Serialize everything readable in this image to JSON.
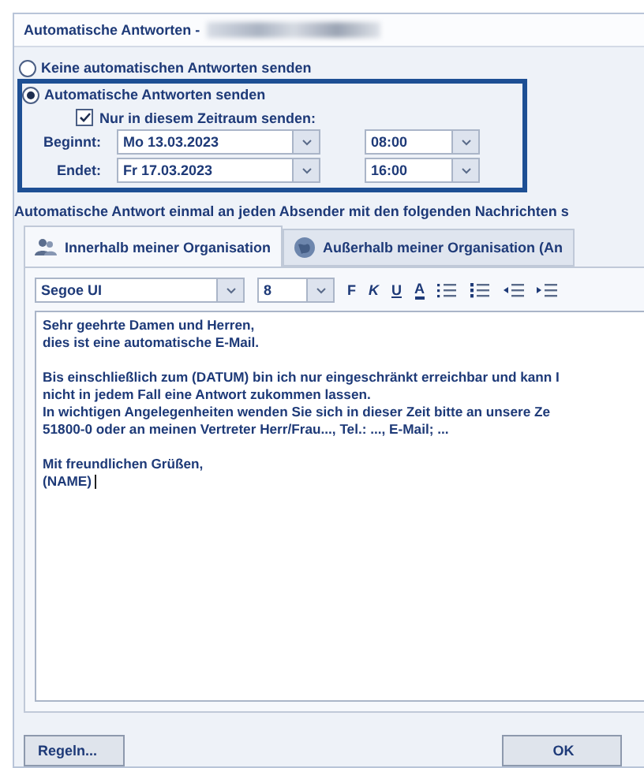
{
  "window": {
    "title": "Automatische Antworten -"
  },
  "options": [
    {
      "label": "Keine automatischen Antworten senden",
      "selected": false
    },
    {
      "label": "Automatische Antworten senden",
      "selected": true
    }
  ],
  "period": {
    "label": "Nur in diesem Zeitraum senden:",
    "checked": true,
    "rows": [
      {
        "label": "Beginnt:",
        "date": "Mo 13.03.2023",
        "time": "08:00"
      },
      {
        "label": "Endet:",
        "date": "Fr 17.03.2023",
        "time": "16:00"
      }
    ]
  },
  "info": "Automatische Antwort einmal an jeden Absender mit den folgenden Nachrichten s",
  "tabs": [
    {
      "label": "Innerhalb meiner Organisation",
      "selected": true,
      "kind": "people"
    },
    {
      "label": "Außerhalb meiner Organisation (An",
      "selected": false,
      "kind": "globe"
    }
  ],
  "toolbar": {
    "font": "Segoe UI",
    "size": "8",
    "formats": [
      {
        "label": "F",
        "kind": "bold"
      },
      {
        "label": "K",
        "kind": "italic"
      },
      {
        "label": "U",
        "kind": "underline"
      },
      {
        "label": "A",
        "kind": "color"
      }
    ]
  },
  "message": [
    [
      "Sehr geehrte Damen und Herren,",
      "dies ist eine automatische E-Mail."
    ],
    [
      "Bis einschließlich zum (DATUM) bin ich nur eingeschränkt erreichbar und kann I",
      "nicht in jedem Fall eine Antwort zukommen lassen.",
      "In wichtigen Angelegenheiten wenden Sie sich in dieser Zeit bitte an unsere Ze",
      "51800-0 oder an meinen Vertreter Herr/Frau..., Tel.: ..., E-Mail; ..."
    ],
    [
      "Mit freundlichen Grüßen,",
      "(NAME)"
    ]
  ],
  "buttons": [
    {
      "label": "Regeln...",
      "kind": "rules"
    },
    {
      "label": "OK",
      "kind": "ok"
    }
  ]
}
